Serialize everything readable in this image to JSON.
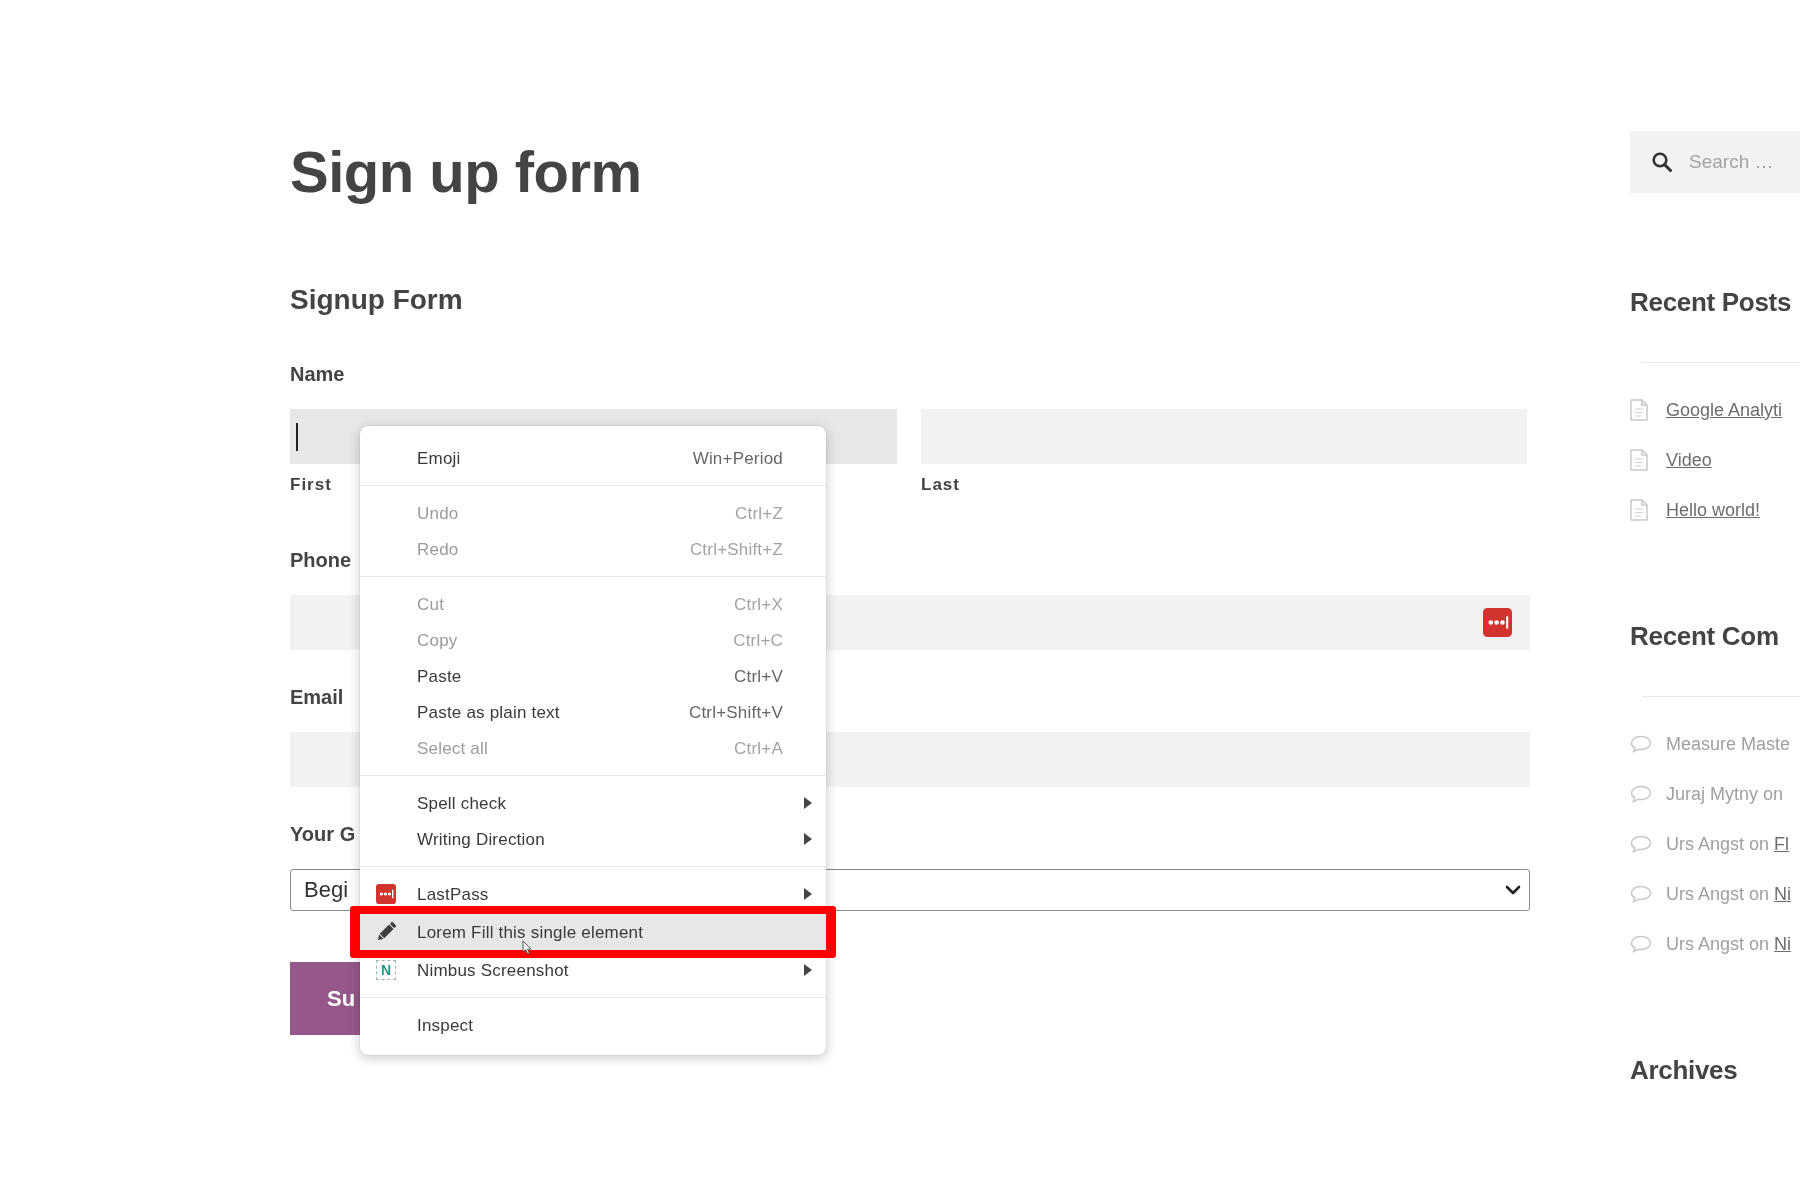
{
  "page_title": "Sign up form",
  "form": {
    "title": "Signup Form",
    "fields": [
      {
        "kind": "name",
        "label": "Name",
        "parts": [
          {
            "sublabel": "First",
            "focused": true
          },
          {
            "sublabel": "Last",
            "focused": false
          }
        ]
      },
      {
        "kind": "text",
        "label": "Phone",
        "focused": false,
        "autofill_icon": true
      },
      {
        "kind": "text",
        "label": "Email",
        "focused": false,
        "autofill_icon": false
      },
      {
        "kind": "select",
        "label": "Your G",
        "value": "Begi"
      }
    ],
    "submit": "Su"
  },
  "sidebar": {
    "search": {
      "placeholder": "Search …"
    },
    "widgets": [
      {
        "kind": "posts",
        "title": "Recent Posts",
        "items": [
          {
            "link": "Google Analyti"
          },
          {
            "link": "Video"
          },
          {
            "link": "Hello world!"
          }
        ]
      },
      {
        "kind": "comments",
        "title": "Recent Com",
        "items": [
          {
            "text": "Measure Maste"
          },
          {
            "text": "Juraj Mytny on"
          },
          {
            "text": "Urs Angst on",
            "link": "Fl"
          },
          {
            "text": "Urs Angst on",
            "link": "Ni"
          },
          {
            "text": "Urs Angst on",
            "link": "Ni"
          }
        ]
      },
      {
        "kind": "archives",
        "title": "Archives"
      }
    ]
  },
  "context_menu": {
    "sections": [
      {
        "items": [
          {
            "kind": "command",
            "label": "Emoji",
            "shortcut": "Win+Period",
            "disabled": false,
            "submenu": false,
            "highlighted": false
          }
        ]
      },
      {
        "items": [
          {
            "kind": "command",
            "label": "Undo",
            "shortcut": "Ctrl+Z",
            "disabled": true,
            "submenu": false,
            "highlighted": false
          },
          {
            "kind": "command",
            "label": "Redo",
            "shortcut": "Ctrl+Shift+Z",
            "disabled": true,
            "submenu": false,
            "highlighted": false
          }
        ]
      },
      {
        "items": [
          {
            "kind": "command",
            "label": "Cut",
            "shortcut": "Ctrl+X",
            "disabled": true,
            "submenu": false,
            "highlighted": false
          },
          {
            "kind": "command",
            "label": "Copy",
            "shortcut": "Ctrl+C",
            "disabled": true,
            "submenu": false,
            "highlighted": false
          },
          {
            "kind": "command",
            "label": "Paste",
            "shortcut": "Ctrl+V",
            "disabled": false,
            "submenu": false,
            "highlighted": false
          },
          {
            "kind": "command",
            "label": "Paste as plain text",
            "shortcut": "Ctrl+Shift+V",
            "disabled": false,
            "submenu": false,
            "highlighted": false
          },
          {
            "kind": "command",
            "label": "Select all",
            "shortcut": "Ctrl+A",
            "disabled": true,
            "submenu": false,
            "highlighted": false
          }
        ]
      },
      {
        "items": [
          {
            "kind": "command",
            "label": "Spell check",
            "disabled": false,
            "submenu": true,
            "highlighted": false
          },
          {
            "kind": "command",
            "label": "Writing Direction",
            "disabled": false,
            "submenu": true,
            "highlighted": false
          }
        ]
      },
      {
        "items": [
          {
            "kind": "extension",
            "label": "LastPass",
            "disabled": false,
            "submenu": true,
            "highlighted": false
          },
          {
            "kind": "extension",
            "label": "Lorem Fill this single element",
            "disabled": false,
            "submenu": false,
            "highlighted": true
          },
          {
            "kind": "extension",
            "label": "Nimbus Screenshot",
            "logo_text": "N",
            "disabled": false,
            "submenu": true,
            "highlighted": false
          }
        ]
      },
      {
        "items": [
          {
            "kind": "command",
            "label": "Inspect",
            "disabled": false,
            "submenu": false,
            "highlighted": false
          }
        ]
      }
    ]
  }
}
